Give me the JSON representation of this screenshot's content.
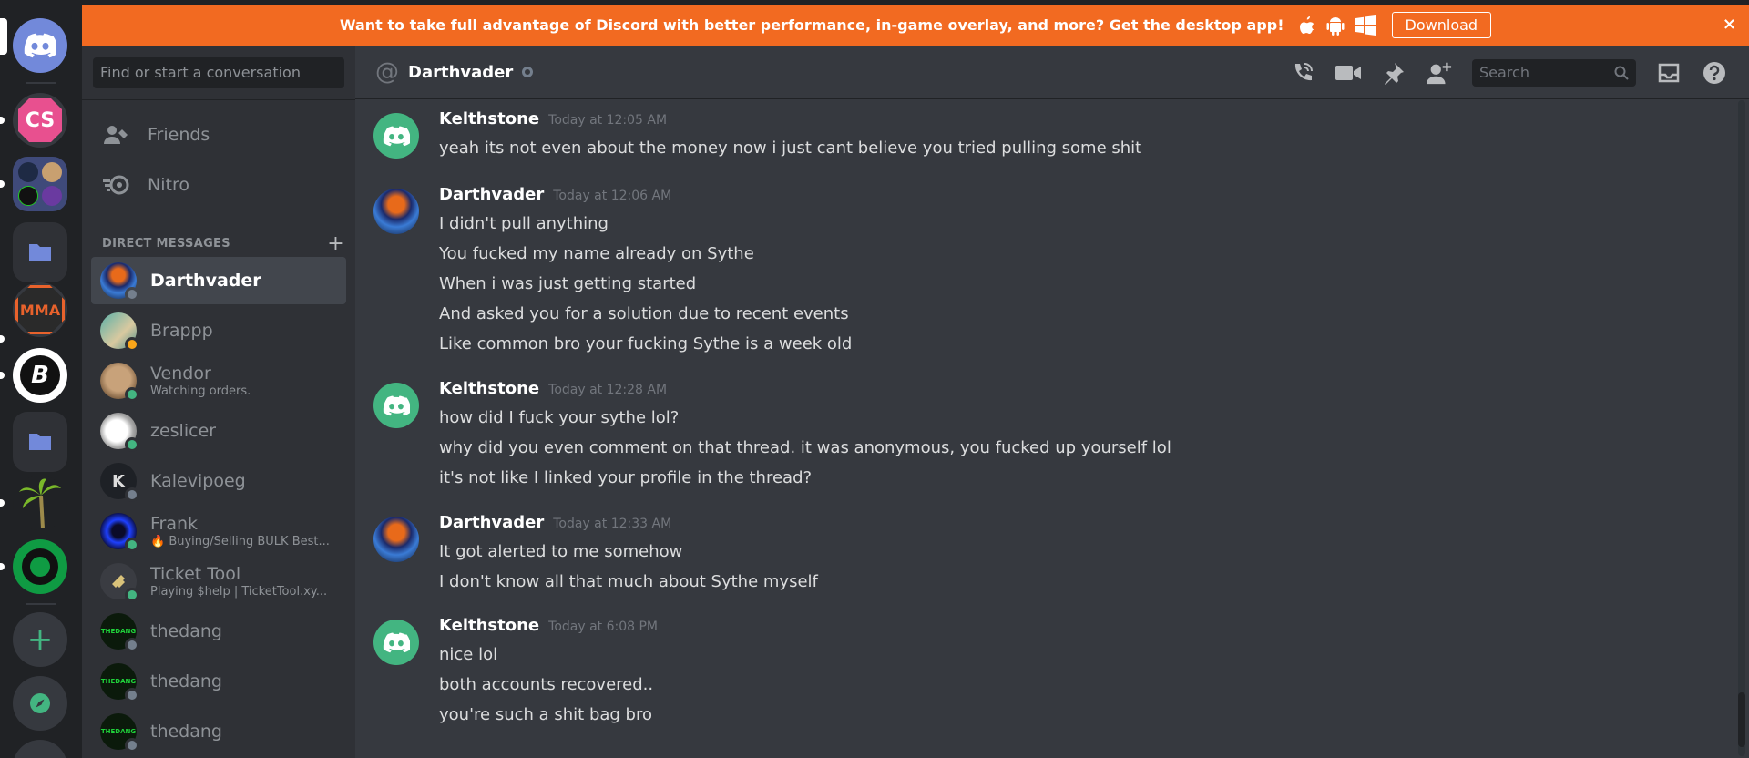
{
  "banner": {
    "text": "Want to take full advantage of Discord with better performance, in-game overlay, and more? Get the desktop app!",
    "download_label": "Download",
    "close_glyph": "×",
    "os_icons": [
      "apple-icon",
      "android-icon",
      "windows-icon"
    ]
  },
  "rail": {
    "servers": [
      {
        "name": "home",
        "icon": "discord-logo-icon"
      },
      {
        "name": "cs",
        "label": "CS"
      },
      {
        "name": "server-folder-1",
        "icon": "server-grid-icon"
      },
      {
        "name": "folder-1",
        "icon": "folder-icon"
      },
      {
        "name": "mma",
        "label": "MMA"
      },
      {
        "name": "b-server",
        "label": "B"
      },
      {
        "name": "folder-2",
        "icon": "folder-icon"
      },
      {
        "name": "palm-server",
        "icon": "palm-icon"
      },
      {
        "name": "green-ring-server",
        "icon": "ring-icon"
      }
    ],
    "add_glyph": "+",
    "explore_icon": "compass-icon"
  },
  "sidebar": {
    "search_placeholder": "Find or start a conversation",
    "nav": [
      {
        "label": "Friends",
        "icon": "friends-icon"
      },
      {
        "label": "Nitro",
        "icon": "nitro-icon"
      }
    ],
    "dm_header": "DIRECT MESSAGES",
    "dm_add_glyph": "+",
    "dms": [
      {
        "name": "Darthvader",
        "status": "offline",
        "active": true,
        "sub": ""
      },
      {
        "name": "Brappp",
        "status": "idle",
        "sub": ""
      },
      {
        "name": "Vendor",
        "status": "online",
        "sub": "Watching orders."
      },
      {
        "name": "zeslicer",
        "status": "online",
        "sub": ""
      },
      {
        "name": "Kalevipoeg",
        "status": "offline",
        "sub": ""
      },
      {
        "name": "Frank",
        "status": "online",
        "sub": "🔥 Buying/Selling BULK Best..."
      },
      {
        "name": "Ticket Tool",
        "status": "online",
        "sub": "Playing $help | TicketTool.xy..."
      },
      {
        "name": "thedang",
        "status": "offline",
        "sub": ""
      },
      {
        "name": "thedang",
        "status": "offline",
        "sub": ""
      },
      {
        "name": "thedang",
        "status": "offline",
        "sub": ""
      }
    ]
  },
  "header": {
    "at_glyph": "@",
    "title": "Darthvader",
    "search_placeholder": "Search",
    "tools": [
      "call-icon",
      "video-icon",
      "pin-icon",
      "add-member-icon",
      "inbox-icon",
      "help-icon"
    ]
  },
  "messages": [
    {
      "author": "Kelthstone",
      "time": "Today at 12:05 AM",
      "lines": [
        "yeah its not even about the money now i just cant believe you tried pulling some shit"
      ]
    },
    {
      "author": "Darthvader",
      "time": "Today at 12:06 AM",
      "lines": [
        "I didn't pull anything",
        "You fucked my name already on Sythe",
        "When i was just getting started",
        "And asked you for a solution due to recent events",
        "Like common bro your fucking Sythe is a week old"
      ]
    },
    {
      "author": "Kelthstone",
      "time": "Today at 12:28 AM",
      "lines": [
        "how did I fuck your sythe lol?",
        "why did you even comment on that thread. it was anonymous, you fucked up yourself lol",
        "it's not like I linked your profile in the thread?"
      ]
    },
    {
      "author": "Darthvader",
      "time": "Today at 12:33 AM",
      "lines": [
        "It got alerted to me somehow",
        "I don't know all that much about Sythe myself"
      ]
    },
    {
      "author": "Kelthstone",
      "time": "Today at 6:08 PM",
      "lines": [
        "nice lol",
        "both accounts recovered..",
        "you're such a shit bag bro"
      ]
    }
  ],
  "colors": {
    "accent": "#7289da",
    "banner": "#f26a21",
    "online": "#43b581",
    "idle": "#faa61a",
    "offline": "#747f8d",
    "kelthstone_avatar": "#43b581"
  }
}
